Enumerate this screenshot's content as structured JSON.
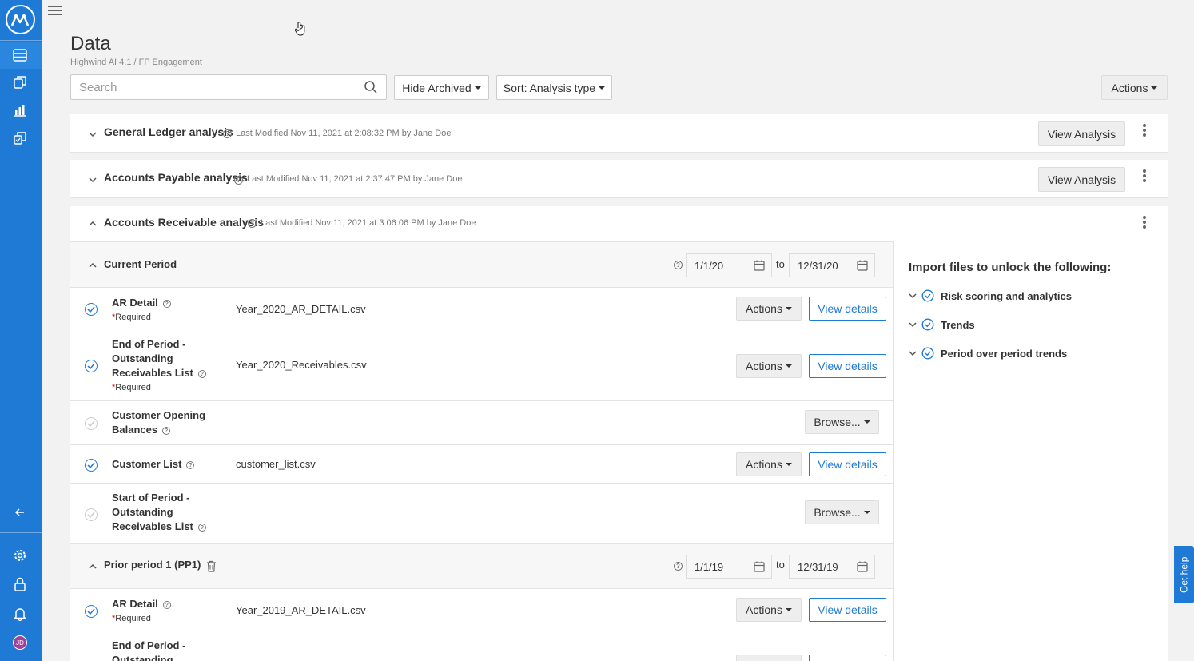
{
  "app": {
    "logo_icon": "app-logo-icon",
    "accent": "#1f7ad6"
  },
  "sidebar": {
    "items": [
      {
        "name": "data-icon"
      },
      {
        "name": "files-icon"
      },
      {
        "name": "chart-icon"
      },
      {
        "name": "engagement-icon"
      },
      {
        "name": "collapse-arrow-icon"
      },
      {
        "name": "gear-icon"
      },
      {
        "name": "lock-icon"
      },
      {
        "name": "bell-icon"
      }
    ],
    "avatar_initials": "JD"
  },
  "header": {
    "title": "Data",
    "breadcrumb": "Highwind AI 4.1 / FP Engagement"
  },
  "toolbar": {
    "search_placeholder": "Search",
    "hide_archived": "Hide Archived",
    "sort": "Sort: Analysis type",
    "actions": "Actions"
  },
  "analyses": [
    {
      "title": "General Ledger analysis",
      "modified": "Last Modified Nov 11, 2021 at 2:08:32 PM by Jane Doe",
      "button": "View Analysis"
    },
    {
      "title": "Accounts Payable analysis",
      "modified": "Last Modified Nov 11, 2021 at 2:37:47 PM by Jane Doe",
      "button": "View Analysis"
    },
    {
      "title": "Accounts Receivable analysis",
      "modified": "Last Modified Nov 11, 2021 at 3:06:06 PM by Jane Doe"
    }
  ],
  "current_period": {
    "title": "Current Period",
    "from": "1/1/20",
    "to_label": "to",
    "to": "12/31/20",
    "rows": [
      {
        "label": "AR Detail",
        "required": "Required",
        "file": "Year_2020_AR_DETAIL.csv",
        "actions": "Actions",
        "view": "View details"
      },
      {
        "label": "End of Period - Outstanding Receivables List",
        "required": "Required",
        "file": "Year_2020_Receivables.csv",
        "actions": "Actions",
        "view": "View details"
      },
      {
        "label": "Customer Opening Balances",
        "browse": "Browse..."
      },
      {
        "label": "Customer List",
        "file": "customer_list.csv",
        "actions": "Actions",
        "view": "View details"
      },
      {
        "label": "Start of Period - Outstanding Receivables List",
        "browse": "Browse..."
      }
    ]
  },
  "prior_period": {
    "title": "Prior period 1 (PP1)",
    "from": "1/1/19",
    "to_label": "to",
    "to": "12/31/19",
    "rows": [
      {
        "label": "AR Detail",
        "required": "Required",
        "file": "Year_2019_AR_DETAIL.csv",
        "actions": "Actions",
        "view": "View details"
      },
      {
        "label": "End of Period - Outstanding"
      }
    ]
  },
  "unlock": {
    "title": "Import files to unlock the following:",
    "items": [
      "Risk scoring and analytics",
      "Trends",
      "Period over period trends"
    ]
  },
  "help": {
    "label": "Get help"
  }
}
